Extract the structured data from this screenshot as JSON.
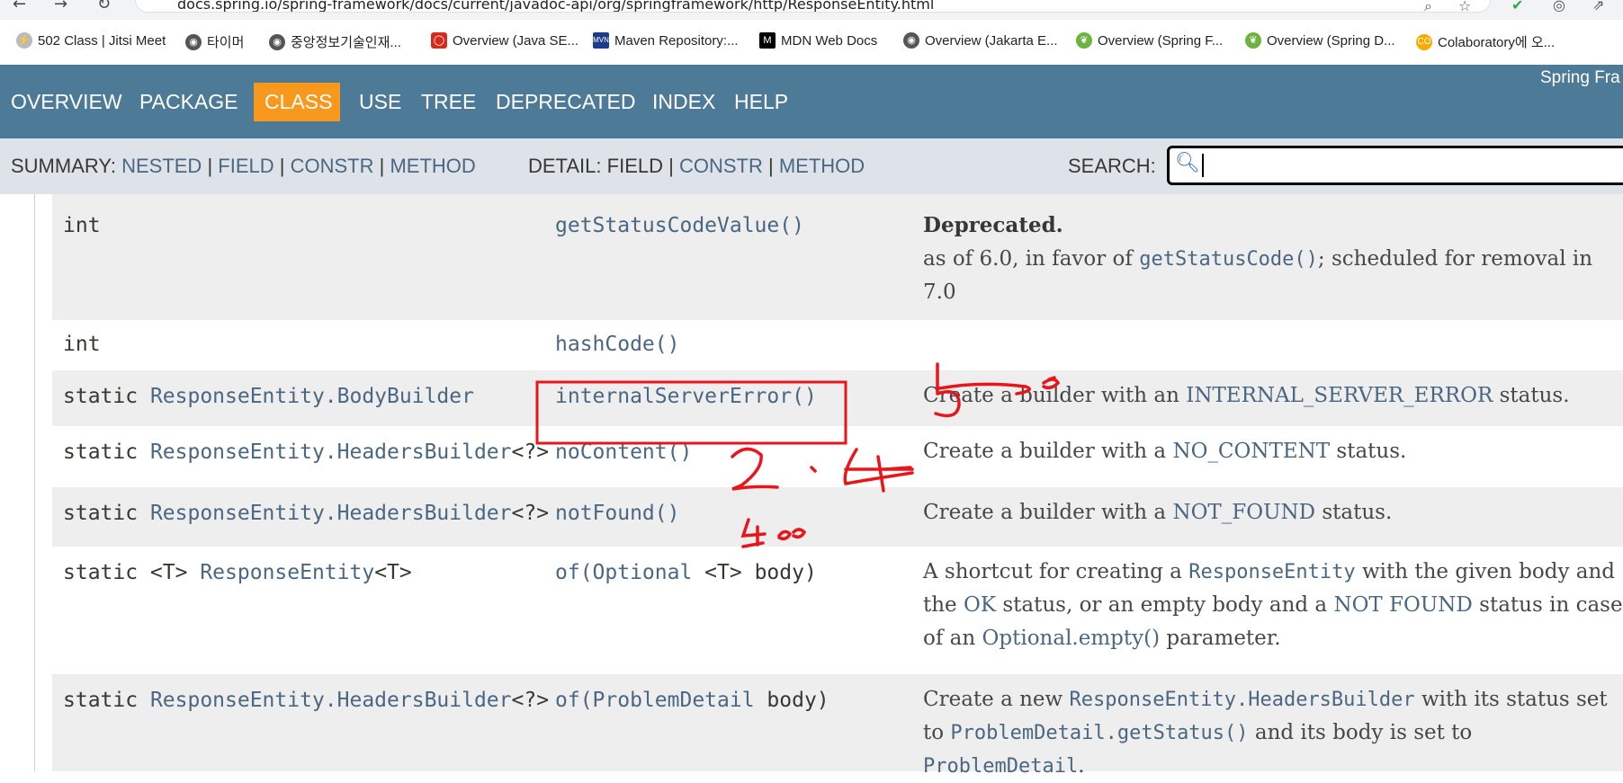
{
  "browser": {
    "url": "docs.spring.io/spring-framework/docs/current/javadoc-api/org/springframework/http/ResponseEntity.html",
    "bookmarks": [
      {
        "label": "502 Class | Jitsi Meet"
      },
      {
        "label": "타이머"
      },
      {
        "label": "중앙정보기술인재..."
      },
      {
        "label": "Overview (Java SE..."
      },
      {
        "label": "Maven Repository:..."
      },
      {
        "label": "MDN Web Docs"
      },
      {
        "label": "Overview (Jakarta E..."
      },
      {
        "label": "Overview (Spring F..."
      },
      {
        "label": "Overview (Spring D..."
      },
      {
        "label": "Colaboratory에 오..."
      }
    ]
  },
  "nav": {
    "items": [
      "OVERVIEW",
      "PACKAGE",
      "CLASS",
      "USE",
      "TREE",
      "DEPRECATED",
      "INDEX",
      "HELP"
    ],
    "brand": "Spring Fra"
  },
  "subnav": {
    "summary_label": "SUMMARY:",
    "summary_links": [
      "NESTED",
      "FIELD",
      "CONSTR",
      "METHOD"
    ],
    "detail_label": "DETAIL:",
    "detail_field": "FIELD",
    "detail_links": [
      "CONSTR",
      "METHOD"
    ],
    "sep": "|",
    "search_label": "SEARCH:"
  },
  "rows": [
    {
      "mod_prefix": "int",
      "mod_link": "",
      "mod_suffix": "",
      "method": "getStatusCodeValue()",
      "desc_bold": "Deprecated.",
      "desc_a": "as of 6.0, in favor of ",
      "desc_code": "getStatusCode()",
      "desc_b": "; scheduled for removal in 7.0"
    },
    {
      "mod_prefix": "int",
      "mod_link": "",
      "mod_suffix": "",
      "method": "hashCode()"
    },
    {
      "mod_prefix": "static ",
      "mod_link": "ResponseEntity.BodyBuilder",
      "mod_suffix": "",
      "method": "internalServerError()",
      "desc_a": "Create a builder with an ",
      "desc_link": "INTERNAL_SERVER_ERROR",
      "desc_b": " status."
    },
    {
      "mod_prefix": "static ",
      "mod_link": "ResponseEntity.HeadersBuilder",
      "mod_suffix": "<?>",
      "method": "noContent()",
      "desc_a": "Create a builder with a ",
      "desc_link": "NO_CONTENT",
      "desc_b": " status."
    },
    {
      "mod_prefix": "static ",
      "mod_link": "ResponseEntity.HeadersBuilder",
      "mod_suffix": "<?>",
      "method": "notFound()",
      "desc_a": "Create a builder with a ",
      "desc_link": "NOT_FOUND",
      "desc_b": " status."
    },
    {
      "mod_prefix": "static <T> ",
      "mod_link": "ResponseEntity",
      "mod_suffix": "<T>",
      "method_name": "of(",
      "method_arg_link": "Optional",
      "method_rest": " <T> body)",
      "desc_a": "A shortcut for creating a ",
      "desc_code": "ResponseEntity",
      "desc_b": " with the given body and the ",
      "desc_link": "OK",
      "desc_c": " status, or an empty body and a ",
      "desc_link2": "NOT FOUND",
      "desc_d": " status in case of an ",
      "desc_link3": "Optional.empty()",
      "desc_e": "   parameter."
    },
    {
      "mod_prefix": "static ",
      "mod_link": "ResponseEntity.HeadersBuilder",
      "mod_suffix": "<?>",
      "method_name": "of(",
      "method_arg_link": "ProblemDetail",
      "method_rest": " body)",
      "desc_a": "Create a new ",
      "desc_code": "ResponseEntity.HeadersBuilder",
      "desc_b": " with its status set to ",
      "desc_code2": "ProblemDetail.getStatus()",
      "desc_c": " and its body is set to ",
      "desc_code3": "ProblemDetail",
      "desc_d": "."
    }
  ],
  "colors": {
    "nav_bg": "#4d7a97",
    "nav_active": "#f8981d",
    "subnav_bg": "#dee3e9",
    "link": "#4a6782",
    "annotation": "#e8161b"
  }
}
